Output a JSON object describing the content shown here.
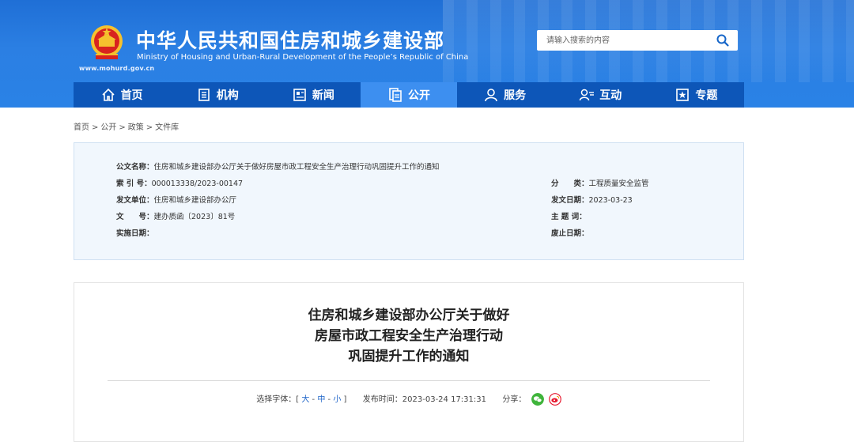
{
  "header": {
    "title": "中华人民共和国住房和城乡建设部",
    "subtitle": "Ministry of Housing and Urban-Rural Development of the People’s Republic of China",
    "url": "www.mohurd.gov.cn",
    "search_placeholder": "请输入搜索的内容",
    "emblem_icon": "national-emblem-icon",
    "accent_color": "#2a82e6",
    "nav_color": "#0d56b8",
    "nav_active_color": "#3d8ff0"
  },
  "nav": {
    "items": [
      {
        "label": "首页",
        "icon": "home-icon"
      },
      {
        "label": "机构",
        "icon": "building-icon"
      },
      {
        "label": "新闻",
        "icon": "news-icon"
      },
      {
        "label": "公开",
        "icon": "document-icon",
        "active": true
      },
      {
        "label": "服务",
        "icon": "user-service-icon"
      },
      {
        "label": "互动",
        "icon": "interaction-icon"
      },
      {
        "label": "专题",
        "icon": "topic-icon"
      }
    ]
  },
  "breadcrumb": {
    "items": [
      "首页",
      "公开",
      "政策",
      "文件库"
    ],
    "separator": ">"
  },
  "info": {
    "doc_name_label": "公文名称：",
    "doc_name": "住房和城乡建设部办公厅关于做好房屋市政工程安全生产治理行动巩固提升工作的通知",
    "index_label": "索 引 号：",
    "index": "000013338/2023-00147",
    "category_label": "分　　类：",
    "category": "工程质量安全监管",
    "issuer_label": "发文单位：",
    "issuer": "住房和城乡建设部办公厅",
    "issue_date_label": "发文日期：",
    "issue_date": "2023-03-23",
    "doc_no_label": "文　　号：",
    "doc_no": "建办质函〔2023〕81号",
    "keywords_label": "主 题 词：",
    "keywords": "",
    "effective_label": "实施日期：",
    "effective": "",
    "expiry_label": "废止日期：",
    "expiry": ""
  },
  "article": {
    "title_lines": [
      "住房和城乡建设部办公厅关于做好",
      "房屋市政工程安全生产治理行动",
      "巩固提升工作的通知"
    ],
    "font_label": "选择字体：[",
    "font_large": "大",
    "font_medium": "中",
    "font_small": "小",
    "font_dash": "-",
    "font_close": "]",
    "publish_label": "发布时间：",
    "publish_time": "2023-03-24 17:31:31",
    "share_label": "分享：",
    "share_icons": [
      "wechat-icon",
      "weibo-icon"
    ],
    "wechat_color": "#3fb43b",
    "weibo_color": "#e6162d"
  }
}
